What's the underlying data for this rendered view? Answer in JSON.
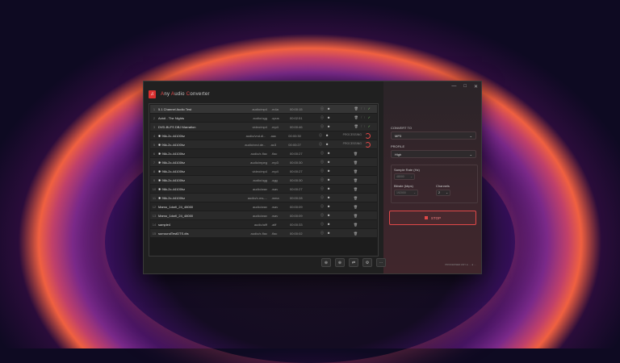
{
  "app": {
    "title_a": "A",
    "title_rest1": "ny ",
    "title_b": "A",
    "title_rest2": "udio ",
    "title_c": "C",
    "title_rest3": "onverter",
    "logo_glyph": "♫"
  },
  "window_controls": {
    "minimize": "—",
    "maximize": "□",
    "close": "✕"
  },
  "files": [
    {
      "num": "1",
      "name": "5.1 Channel Audio Test",
      "mime": "audio/mp4",
      "ext": ".m4a",
      "dur": "00:00:15",
      "state": "done"
    },
    {
      "num": "2",
      "name": "Avicii - The Nights",
      "mime": "audio/ogg",
      "ext": ".opus",
      "dur": "00:02:51",
      "state": "done"
    },
    {
      "num": "3",
      "name": "DVD-BLFS DBJ Marration",
      "mime": "video/mp4",
      "ext": ".mp4",
      "dur": "00:00:46",
      "state": "done"
    },
    {
      "num": "4",
      "name": "✱ 96k-2c-44100hz",
      "mime": "audio/vnd.dl...",
      "ext": ".aac",
      "dur": "00:00:30",
      "state": "processing"
    },
    {
      "num": "5",
      "name": "✱ 96k-2c-44100hz",
      "mime": "audio/vnd.de...",
      "ext": ".ac3",
      "dur": "00:00:27",
      "state": "processing"
    },
    {
      "num": "6",
      "name": "✱ 96k-2c-44100hz",
      "mime": "audio/x-flac",
      "ext": ".flac",
      "dur": "00:00:27",
      "state": "idle"
    },
    {
      "num": "7",
      "name": "✱ 96k-2c-44100hz",
      "mime": "audio/mpeg",
      "ext": ".mp3",
      "dur": "00:00:30",
      "state": "idle"
    },
    {
      "num": "8",
      "name": "✱ 96k-2c-44100hz",
      "mime": "video/mp4",
      "ext": ".mp4",
      "dur": "00:00:27",
      "state": "idle"
    },
    {
      "num": "9",
      "name": "✱ 96k-2c-44100hz",
      "mime": "audio/ogg",
      "ext": ".ogg",
      "dur": "00:00:30",
      "state": "idle"
    },
    {
      "num": "10",
      "name": "✱ 96k-2c-44100hz",
      "mime": "audio/wav",
      "ext": ".wav",
      "dur": "00:00:27",
      "state": "idle"
    },
    {
      "num": "11",
      "name": "✱ 96k-2c-44100hz",
      "mime": "audio/x-ms-...",
      "ext": ".wma",
      "dur": "00:00:28",
      "state": "idle"
    },
    {
      "num": "12",
      "name": "Mamo_1dorll_24_48000",
      "mime": "audio/wav",
      "ext": ".wav",
      "dur": "00:00:09",
      "state": "idle"
    },
    {
      "num": "13",
      "name": "Mamo_1dorll_24_48000",
      "mime": "audio/wav",
      "ext": ".wav",
      "dur": "00:00:09",
      "state": "idle"
    },
    {
      "num": "14",
      "name": "sample4",
      "mime": "audio/aiff",
      "ext": ".aiff",
      "dur": "00:00:33",
      "state": "idle"
    },
    {
      "num": "15",
      "name": "surroundTestDTS.dts",
      "mime": "audio/x-flac",
      "ext": ".flac",
      "dur": "00:00:02",
      "state": "idle"
    }
  ],
  "processing_label": "PROCESSING",
  "toolbar": [
    "⊕",
    "⊕",
    "⇄",
    "⚙",
    "⋯"
  ],
  "convert_to": {
    "label": "CONVERT TO",
    "value": "MP3"
  },
  "profile": {
    "label": "PROFILE",
    "value": "High"
  },
  "advanced": {
    "sample_rate_label": "Sample Rate (Hz)",
    "sample_rate_value": "48000",
    "bitrate_label": "Bitrate (kbps)",
    "bitrate_value": "192000",
    "channels_label": "Channels",
    "channels_value": "2"
  },
  "start_label": "STOP",
  "footer": "PROCESSED ANY ● ··· ● ···"
}
